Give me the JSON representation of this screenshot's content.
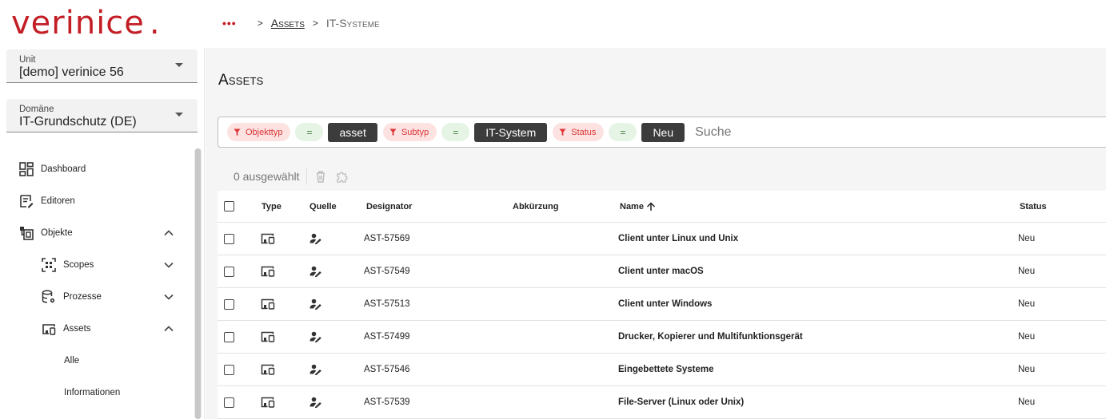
{
  "header": {
    "logo_text": "verinice",
    "logo_dot": ".",
    "breadcrumb": {
      "more": "•••",
      "sep": ">",
      "items": [
        "Assets",
        "IT-Systeme"
      ]
    }
  },
  "sidebar": {
    "unit": {
      "label": "Unit",
      "value": "[demo] verinice 56"
    },
    "domain": {
      "label": "Domäne",
      "value": "IT-Grundschutz (DE)"
    },
    "nav": [
      {
        "label": "Dashboard",
        "icon": "dashboard-icon"
      },
      {
        "label": "Editoren",
        "icon": "editor-icon"
      },
      {
        "label": "Objekte",
        "icon": "objects-icon",
        "expanded": true
      },
      {
        "label": "Scopes",
        "icon": "scopes-icon",
        "expanded": false
      },
      {
        "label": "Prozesse",
        "icon": "processes-icon",
        "expanded": false
      },
      {
        "label": "Assets",
        "icon": "assets-icon",
        "expanded": true
      },
      {
        "label": "Alle"
      },
      {
        "label": "Informationen"
      }
    ]
  },
  "main": {
    "title": "Assets",
    "filters": [
      {
        "key": "Objekttyp",
        "op": "=",
        "value": "asset"
      },
      {
        "key": "Subtyp",
        "op": "=",
        "value": "IT-System"
      },
      {
        "key": "Status",
        "op": "=",
        "value": "Neu"
      }
    ],
    "search_placeholder": "Suche",
    "selection": {
      "count_text": "0 ausgewählt"
    },
    "table": {
      "columns": {
        "type": "Type",
        "source": "Quelle",
        "designator": "Designator",
        "abbreviation": "Abkürzung",
        "name": "Name",
        "status": "Status"
      },
      "sort": {
        "column": "name",
        "direction": "asc"
      },
      "rows": [
        {
          "designator": "AST-57569",
          "abbreviation": "",
          "name": "Client unter Linux und Unix",
          "status": "Neu"
        },
        {
          "designator": "AST-57549",
          "abbreviation": "",
          "name": "Client unter macOS",
          "status": "Neu"
        },
        {
          "designator": "AST-57513",
          "abbreviation": "",
          "name": "Client unter Windows",
          "status": "Neu"
        },
        {
          "designator": "AST-57499",
          "abbreviation": "",
          "name": "Drucker, Kopierer und Multifunktionsgerät",
          "status": "Neu"
        },
        {
          "designator": "AST-57546",
          "abbreviation": "",
          "name": "Eingebettete Systeme",
          "status": "Neu"
        },
        {
          "designator": "AST-57539",
          "abbreviation": "",
          "name": "File-Server (Linux oder Unix)",
          "status": "Neu"
        }
      ]
    }
  },
  "colors": {
    "brand": "#c31e25",
    "chip_key_bg": "#fde2e2",
    "chip_op_bg": "#e6f4e6",
    "chip_value_bg": "#3c3c3c"
  }
}
